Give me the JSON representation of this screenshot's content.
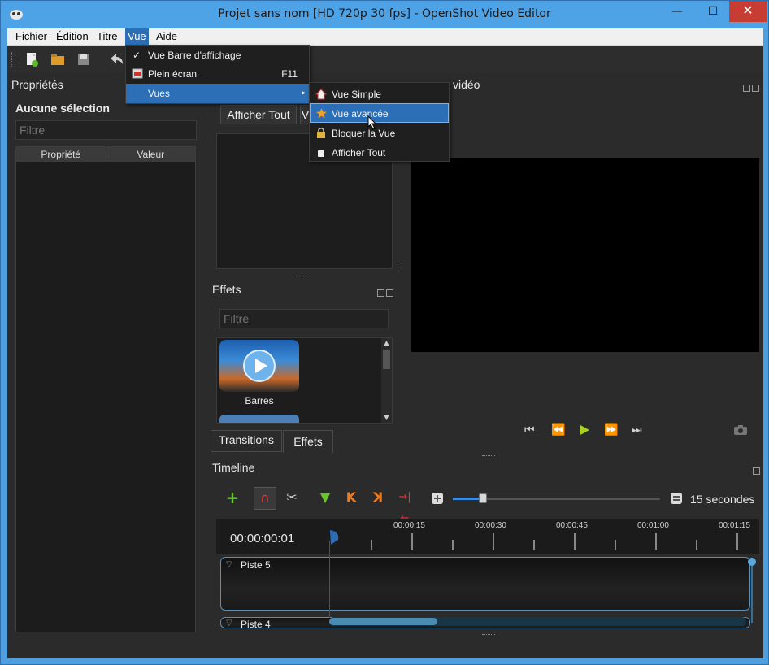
{
  "window": {
    "title": "Projet sans nom [HD 720p 30 fps] - OpenShot Video Editor",
    "minimize": "—",
    "maximize": "☐",
    "close": "✕"
  },
  "menubar": {
    "items": [
      {
        "label": "Fichier"
      },
      {
        "label": "Édition"
      },
      {
        "label": "Titre"
      },
      {
        "label": "Vue"
      },
      {
        "label": "Aide"
      }
    ]
  },
  "view_menu": {
    "items": [
      {
        "label": "Vue Barre d'affichage",
        "check": "✓",
        "shortcut": ""
      },
      {
        "label": "Plein écran",
        "shortcut": "F11"
      },
      {
        "label": "Vues",
        "submenu_arrow": "▸"
      }
    ]
  },
  "views_submenu": {
    "items": [
      {
        "label": "Vue Simple",
        "icon": "home-icon"
      },
      {
        "label": "Vue avancée",
        "icon": "star-icon"
      },
      {
        "label": "Bloquer la Vue",
        "icon": "lock-icon"
      },
      {
        "label": "Afficher Tout",
        "icon": "window-icon"
      }
    ]
  },
  "properties": {
    "title": "Propriétés",
    "selection": "Aucune sélection",
    "filter_placeholder": "Filtre",
    "columns": [
      "Propriété",
      "Valeur"
    ]
  },
  "files_panel": {
    "show_all": "Afficher Tout",
    "partial_button": "V"
  },
  "effects": {
    "title": "Effets",
    "filter_placeholder": "Filtre",
    "items": [
      {
        "label": "Barres"
      }
    ]
  },
  "tabs": {
    "transitions": "Transitions",
    "effects": "Effets"
  },
  "preview": {
    "title": "Aperçu vidéo",
    "visible_fragment": "vidéo"
  },
  "timeline": {
    "title": "Timeline",
    "timecode": "00:00:00:01",
    "zoom_label": "15 secondes",
    "ruler_labels": [
      "00:00:15",
      "00:00:30",
      "00:00:45",
      "00:01:00",
      "00:01:15"
    ],
    "tracks": [
      {
        "label": "Piste 5"
      },
      {
        "label": "Piste 4"
      }
    ]
  },
  "colors": {
    "accent": "#2c6fb6",
    "playhead": "#d11a1a",
    "track_border": "#5b8fb5"
  }
}
